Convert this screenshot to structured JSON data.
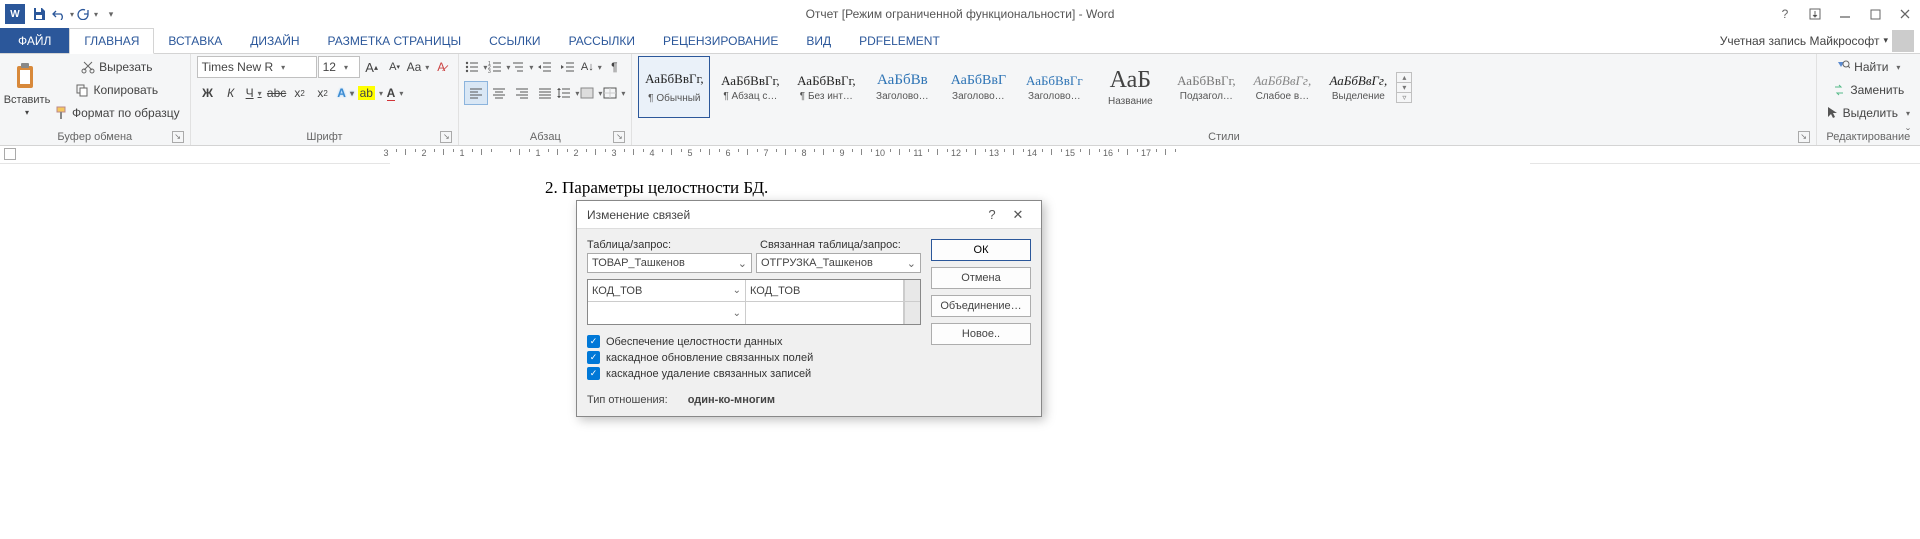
{
  "title": "Отчет [Режим ограниченной функциональности] - Word",
  "account": "Учетная запись Майкрософт",
  "tabs": {
    "file": "ФАЙЛ",
    "home": "ГЛАВНАЯ",
    "insert": "ВСТАВКА",
    "design": "ДИЗАЙН",
    "layout": "РАЗМЕТКА СТРАНИЦЫ",
    "refs": "ССЫЛКИ",
    "mail": "РАССЫЛКИ",
    "review": "РЕЦЕНЗИРОВАНИЕ",
    "view": "ВИД",
    "pdf": "PDFelement"
  },
  "clipboard": {
    "paste": "Вставить",
    "cut": "Вырезать",
    "copy": "Копировать",
    "fmt": "Формат по образцу",
    "grp": "Буфер обмена"
  },
  "font": {
    "name": "Times New R",
    "size": "12",
    "grp": "Шрифт",
    "bold": "Ж",
    "italic": "К",
    "under": "Ч"
  },
  "para": {
    "grp": "Абзац"
  },
  "styles": {
    "grp": "Стили",
    "list": [
      {
        "preview": "АаБбВвГг,",
        "name": "¶ Обычный"
      },
      {
        "preview": "АаБбВвГг,",
        "name": "¶ Абзац с…"
      },
      {
        "preview": "АаБбВвГг,",
        "name": "¶ Без инт…"
      },
      {
        "preview": "АаБбВв",
        "name": "Заголово…",
        "color": "#2e74b5",
        "size": "15px"
      },
      {
        "preview": "АаБбВвГ",
        "name": "Заголово…",
        "color": "#2e74b5",
        "size": "14px"
      },
      {
        "preview": "АаБбВвГг",
        "name": "Заголово…",
        "color": "#2e74b5",
        "size": "13px"
      },
      {
        "preview": "АаБ",
        "name": "Название",
        "size": "24px",
        "color": "#444"
      },
      {
        "preview": "АаБбВвГг,",
        "name": "Подзагол…",
        "color": "#777"
      },
      {
        "preview": "АаБбВвГг,",
        "name": "Слабое в…",
        "color": "#888",
        "italic": true
      },
      {
        "preview": "АаБбВвГг,",
        "name": "Выделение",
        "italic": true
      }
    ]
  },
  "editing": {
    "find": "Найти",
    "replace": "Заменить",
    "select": "Выделить",
    "grp": "Редактирование"
  },
  "doc": {
    "text": "2. Параметры целостности БД."
  },
  "dialog": {
    "title": "Изменение связей",
    "tbl": "Таблица/запрос:",
    "reltbl": "Связанная таблица/запрос:",
    "t1": "ТОВАР_Ташкенов",
    "t2": "ОТГРУЗКА_Ташкенов",
    "f1": "КОД_ТОВ",
    "f2": "КОД_ТОВ",
    "c1": "Обеспечение целостности данных",
    "c2": "каскадное обновление связанных полей",
    "c3": "каскадное удаление связанных записей",
    "reltypelbl": "Тип отношения:",
    "reltype": "один-ко-многим",
    "ok": "ОК",
    "cancel": "Отмена",
    "join": "Объединение…",
    "new": "Новое.."
  },
  "ruler": {
    "marks": [
      3,
      2,
      1,
      1,
      2,
      3,
      4,
      5,
      6,
      7,
      8,
      9,
      10,
      11,
      12,
      13,
      14,
      15,
      16,
      17
    ]
  }
}
